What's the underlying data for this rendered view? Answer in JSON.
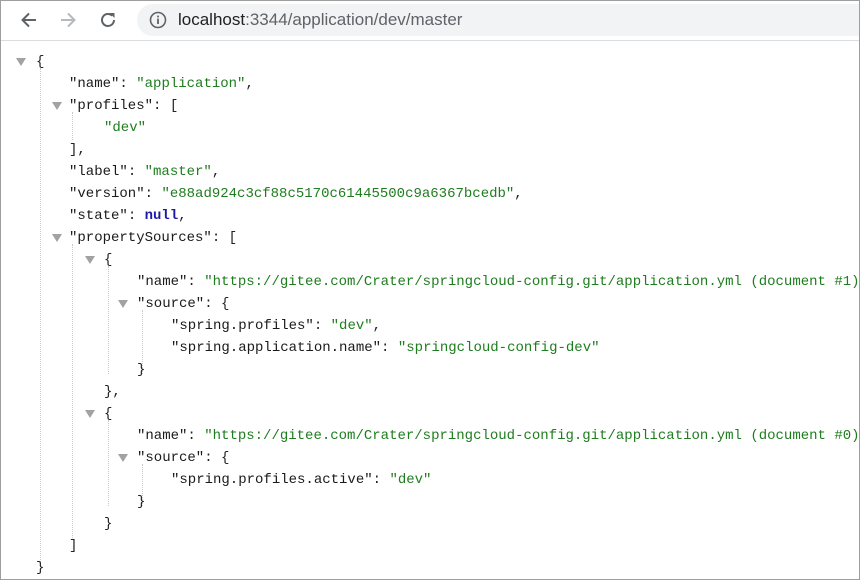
{
  "browser": {
    "url_host": "localhost",
    "url_rest": ":3344/application/dev/master"
  },
  "json": {
    "open_brace": "{",
    "name_key": "\"name\"",
    "name_value": "\"application\"",
    "profiles_key": "\"profiles\"",
    "profiles_item": "\"dev\"",
    "label_key": "\"label\"",
    "label_value": "\"master\"",
    "version_key": "\"version\"",
    "version_value": "\"e88ad924c3cf88c5170c61445500c9a6367bcedb\"",
    "state_key": "\"state\"",
    "state_value": "null",
    "property_sources_key": "\"propertySources\"",
    "sources": [
      {
        "name_key": "\"name\"",
        "name_value": "\"https://gitee.com/Crater/springcloud-config.git/application.yml (document #1)\"",
        "source_key": "\"source\"",
        "props": [
          {
            "key": "\"spring.profiles\"",
            "value": "\"dev\""
          },
          {
            "key": "\"spring.application.name\"",
            "value": "\"springcloud-config-dev\""
          }
        ]
      },
      {
        "name_key": "\"name\"",
        "name_value": "\"https://gitee.com/Crater/springcloud-config.git/application.yml (document #0)\"",
        "source_key": "\"source\"",
        "props": [
          {
            "key": "\"spring.profiles.active\"",
            "value": "\"dev\""
          }
        ]
      }
    ]
  }
}
